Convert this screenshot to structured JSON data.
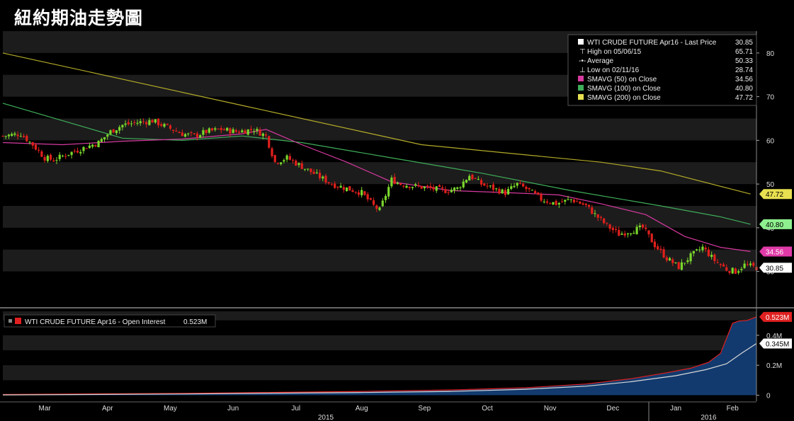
{
  "header": {
    "title": "紐約期油走勢圖"
  },
  "colors": {
    "background": "#000000",
    "price_up": "#7ad62c",
    "price_down": "#e0201c",
    "sma50": "#d63aa0",
    "sma100": "#3fae5a",
    "sma200": "#b3aa28",
    "open_interest_fill": "#123a6e",
    "open_interest_line": "#e02020",
    "aux_line": "#d8d8d8"
  },
  "chart_data": [
    {
      "type": "candlestick",
      "title": "WTI CRUDE FUTURE Apr16 - Last Price",
      "last_price": "30.85",
      "ylim": [
        22,
        85
      ],
      "yticks": [
        30,
        40,
        50,
        60,
        70,
        80
      ],
      "ytick_labels": [
        "30",
        "40",
        "50",
        "60",
        "70",
        "80"
      ],
      "xlim": [
        0,
        252
      ],
      "grid": "horizontal bands",
      "legend_position": "top-right",
      "legend": [
        {
          "marker": "white-square",
          "label": "WTI CRUDE FUTURE Apr16 - Last Price",
          "value": "30.85"
        },
        {
          "marker": "high-icon",
          "label": "High on 05/06/15",
          "value": "65.71"
        },
        {
          "marker": "average-icon",
          "label": "Average",
          "value": "50.33"
        },
        {
          "marker": "low-icon",
          "label": "Low on 02/11/16",
          "value": "28.74"
        },
        {
          "marker": "magenta-square",
          "label": "SMAVG (50) on Close",
          "value": "34.56"
        },
        {
          "marker": "green-square",
          "label": "SMAVG (100) on Close",
          "value": "40.80"
        },
        {
          "marker": "yellow-square",
          "label": "SMAVG (200) on Close",
          "value": "47.72"
        }
      ],
      "price_tags": [
        {
          "value": 47.72,
          "text": "47.72",
          "bg": "#e8e050",
          "fg": "#000000"
        },
        {
          "value": 40.8,
          "text": "40.80",
          "bg": "#8ef08e",
          "fg": "#000000"
        },
        {
          "value": 34.56,
          "text": "34.56",
          "bg": "#e03aa8",
          "fg": "#ffffff"
        },
        {
          "value": 30.85,
          "text": "30.85",
          "bg": "#ffffff",
          "fg": "#000000"
        }
      ],
      "close_path": [
        [
          0,
          61
        ],
        [
          6,
          61.5
        ],
        [
          10,
          59
        ],
        [
          14,
          56
        ],
        [
          17,
          55.5
        ],
        [
          22,
          57
        ],
        [
          28,
          58.5
        ],
        [
          32,
          59.5
        ],
        [
          36,
          62
        ],
        [
          40,
          63.5
        ],
        [
          44,
          64
        ],
        [
          50,
          64.5
        ],
        [
          55,
          63
        ],
        [
          60,
          61.5
        ],
        [
          64,
          61
        ],
        [
          68,
          62
        ],
        [
          73,
          62.5
        ],
        [
          78,
          62
        ],
        [
          84,
          62.5
        ],
        [
          88,
          61
        ],
        [
          91,
          55
        ],
        [
          95,
          56
        ],
        [
          100,
          54
        ],
        [
          105,
          52
        ],
        [
          110,
          50
        ],
        [
          115,
          49
        ],
        [
          120,
          48
        ],
        [
          124,
          45
        ],
        [
          126,
          44
        ],
        [
          130,
          51
        ],
        [
          133,
          50
        ],
        [
          138,
          49.5
        ],
        [
          143,
          49
        ],
        [
          148,
          48.5
        ],
        [
          152,
          49
        ],
        [
          156,
          52
        ],
        [
          160,
          50
        ],
        [
          164,
          49
        ],
        [
          168,
          48
        ],
        [
          172,
          50
        ],
        [
          176,
          48.5
        ],
        [
          180,
          46.5
        ],
        [
          185,
          45.5
        ],
        [
          190,
          46.5
        ],
        [
          195,
          45
        ],
        [
          198,
          43
        ],
        [
          202,
          40.5
        ],
        [
          206,
          38.5
        ],
        [
          211,
          39.5
        ],
        [
          214,
          40
        ],
        [
          218,
          36
        ],
        [
          222,
          33
        ],
        [
          226,
          31
        ],
        [
          230,
          33.5
        ],
        [
          234,
          35.5
        ],
        [
          238,
          32.5
        ],
        [
          242,
          30.5
        ],
        [
          245,
          30
        ],
        [
          248,
          31.5
        ],
        [
          252,
          30.85
        ]
      ],
      "sma50_path": [
        [
          0,
          59.5
        ],
        [
          20,
          59
        ],
        [
          40,
          59.8
        ],
        [
          60,
          60.3
        ],
        [
          80,
          61.5
        ],
        [
          88,
          62.5
        ],
        [
          100,
          59
        ],
        [
          115,
          55
        ],
        [
          130,
          50.5
        ],
        [
          150,
          48.5
        ],
        [
          170,
          48
        ],
        [
          186,
          47.5
        ],
        [
          200,
          45.5
        ],
        [
          215,
          43
        ],
        [
          228,
          38
        ],
        [
          240,
          35.5
        ],
        [
          250,
          34.56
        ]
      ],
      "sma100_path": [
        [
          0,
          68.5
        ],
        [
          20,
          64.5
        ],
        [
          40,
          60.5
        ],
        [
          60,
          60
        ],
        [
          80,
          61
        ],
        [
          100,
          59.5
        ],
        [
          130,
          56
        ],
        [
          160,
          52.5
        ],
        [
          190,
          48.5
        ],
        [
          220,
          45
        ],
        [
          240,
          42.5
        ],
        [
          250,
          40.8
        ]
      ],
      "sma200_path": [
        [
          0,
          80
        ],
        [
          40,
          74
        ],
        [
          80,
          68
        ],
        [
          120,
          62
        ],
        [
          140,
          59
        ],
        [
          170,
          57
        ],
        [
          200,
          55
        ],
        [
          220,
          53
        ],
        [
          250,
          47.72
        ]
      ]
    },
    {
      "type": "area",
      "title": "WTI CRUDE FUTURE Apr16 - Open Interest",
      "last_value": "0.523M",
      "ylim": [
        -0.04,
        0.56
      ],
      "yticks": [
        0,
        0.2,
        0.4
      ],
      "ytick_labels": [
        "0",
        "0.2M",
        "0.4M"
      ],
      "legend_position": "top-left",
      "legend": [
        {
          "marker": "red-square",
          "label": "WTI CRUDE FUTURE Apr16 - Open Interest",
          "value": "0.523M"
        }
      ],
      "value_tags": [
        {
          "value": 0.523,
          "text": "0.523M",
          "bg": "#e02020",
          "fg": "#ffffff"
        },
        {
          "value": 0.345,
          "text": "0.345M",
          "bg": "#ffffff",
          "fg": "#000000"
        }
      ],
      "open_interest": [
        [
          0,
          0.005
        ],
        [
          60,
          0.012
        ],
        [
          120,
          0.025
        ],
        [
          150,
          0.035
        ],
        [
          175,
          0.05
        ],
        [
          195,
          0.075
        ],
        [
          210,
          0.11
        ],
        [
          222,
          0.15
        ],
        [
          230,
          0.18
        ],
        [
          236,
          0.22
        ],
        [
          240,
          0.28
        ],
        [
          242,
          0.38
        ],
        [
          244,
          0.48
        ],
        [
          246,
          0.495
        ],
        [
          249,
          0.5
        ],
        [
          252,
          0.523
        ]
      ],
      "aux_series": [
        [
          0,
          0.002
        ],
        [
          60,
          0.008
        ],
        [
          120,
          0.018
        ],
        [
          150,
          0.025
        ],
        [
          175,
          0.04
        ],
        [
          195,
          0.06
        ],
        [
          210,
          0.09
        ],
        [
          225,
          0.13
        ],
        [
          235,
          0.17
        ],
        [
          242,
          0.21
        ],
        [
          247,
          0.28
        ],
        [
          252,
          0.345
        ]
      ]
    }
  ],
  "x_axis": {
    "months": [
      {
        "label": "Mar",
        "x": 14
      },
      {
        "label": "Apr",
        "x": 35
      },
      {
        "label": "May",
        "x": 56
      },
      {
        "label": "Jun",
        "x": 77
      },
      {
        "label": "Jul",
        "x": 98
      },
      {
        "label": "Aug",
        "x": 120
      },
      {
        "label": "Sep",
        "x": 141
      },
      {
        "label": "Oct",
        "x": 162
      },
      {
        "label": "Nov",
        "x": 183
      },
      {
        "label": "Dec",
        "x": 204
      },
      {
        "label": "Jan",
        "x": 225
      },
      {
        "label": "Feb",
        "x": 244
      }
    ],
    "years": [
      {
        "label": "2015",
        "x": 108
      },
      {
        "label": "2016",
        "x": 236
      }
    ]
  }
}
